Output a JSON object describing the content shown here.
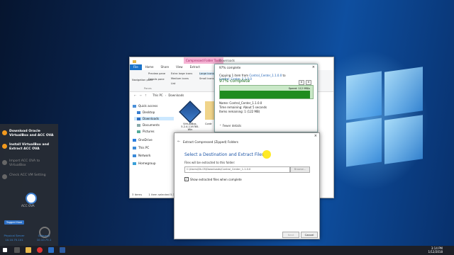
{
  "overlay": {
    "steps": [
      {
        "label": "Download Oracle VirtualBox and ACC OVA",
        "active": true
      },
      {
        "label": "Install VirtualBox and Extract ACC OVA",
        "active": true
      },
      {
        "label": "Import ACC OVA to VirtualBox",
        "active": false
      },
      {
        "label": "Check ACC VM Setting",
        "active": false
      }
    ],
    "node_label": "ACC OVA",
    "button_label": "Tagged Host",
    "physical_server": "Physical Server",
    "physical_ip": "10.10.75.101",
    "gateway": "Gateway",
    "gateway_ip": "10.10.75.1"
  },
  "explorer": {
    "context_tab": "Compressed Folder Tools",
    "window_title": "Downloads",
    "ribbon_tabs": [
      "File",
      "Home",
      "Share",
      "View",
      "Extract"
    ],
    "ribbon_items": [
      "Navigation pane",
      "Preview pane",
      "Details pane",
      "Extra large icons",
      "Large icons",
      "Medium icons",
      "Small icons",
      "List"
    ],
    "group_label": "Panes",
    "address": [
      "This PC",
      "Downloads"
    ],
    "nav_items": [
      "Quick access",
      "Desktop",
      "Downloads",
      "Documents",
      "Pictures",
      "OneDrive",
      "This PC",
      "Network",
      "Homegroup"
    ],
    "selected_nav": "Downloads",
    "file_name": "VirtualBox-5.2.4-119785-Win",
    "partial_name": "Contr",
    "status_count": "3 items",
    "status_selected": "1 item selected 5.36 GB"
  },
  "progress": {
    "title": "97% complete",
    "copying_prefix": "Copying 1 item from",
    "from": "Control_Center_1.1.0.0",
    "to_word": "to",
    "to": "Control_Center_1.1.0.0",
    "percent_label": "97% complete",
    "percent": 97,
    "speed": "Speed: 112 MB/s",
    "name_line": "Name:  Control_Center_1.1.0.0",
    "time_line": "Time remaining:  About 5 seconds",
    "items_line": "Items remaining:  1 (122 MB)",
    "fewer_details": "Fewer details",
    "pause_glyph": "II",
    "cancel_glyph": "✕"
  },
  "extract": {
    "header": "Extract Compressed (Zipped) Folders",
    "heading": "Select a Destination and Extract Files",
    "label": "Files will be extracted to this folder:",
    "path": "C:\\Users\\Dk-05\\Downloads\\Control_Center_1.1.0.0",
    "browse": "Browse...",
    "checkbox_label": "Show extracted files when complete",
    "checked": true,
    "next": "Next",
    "cancel": "Cancel"
  },
  "taskbar": {
    "time": "3:14 PM",
    "date": "1/12/2018"
  },
  "colors": {
    "accent": "#1a73c9",
    "step_active": "#f39a1e",
    "progress_fill": "#1f8c1f",
    "heading_blue": "#1d55a6"
  }
}
